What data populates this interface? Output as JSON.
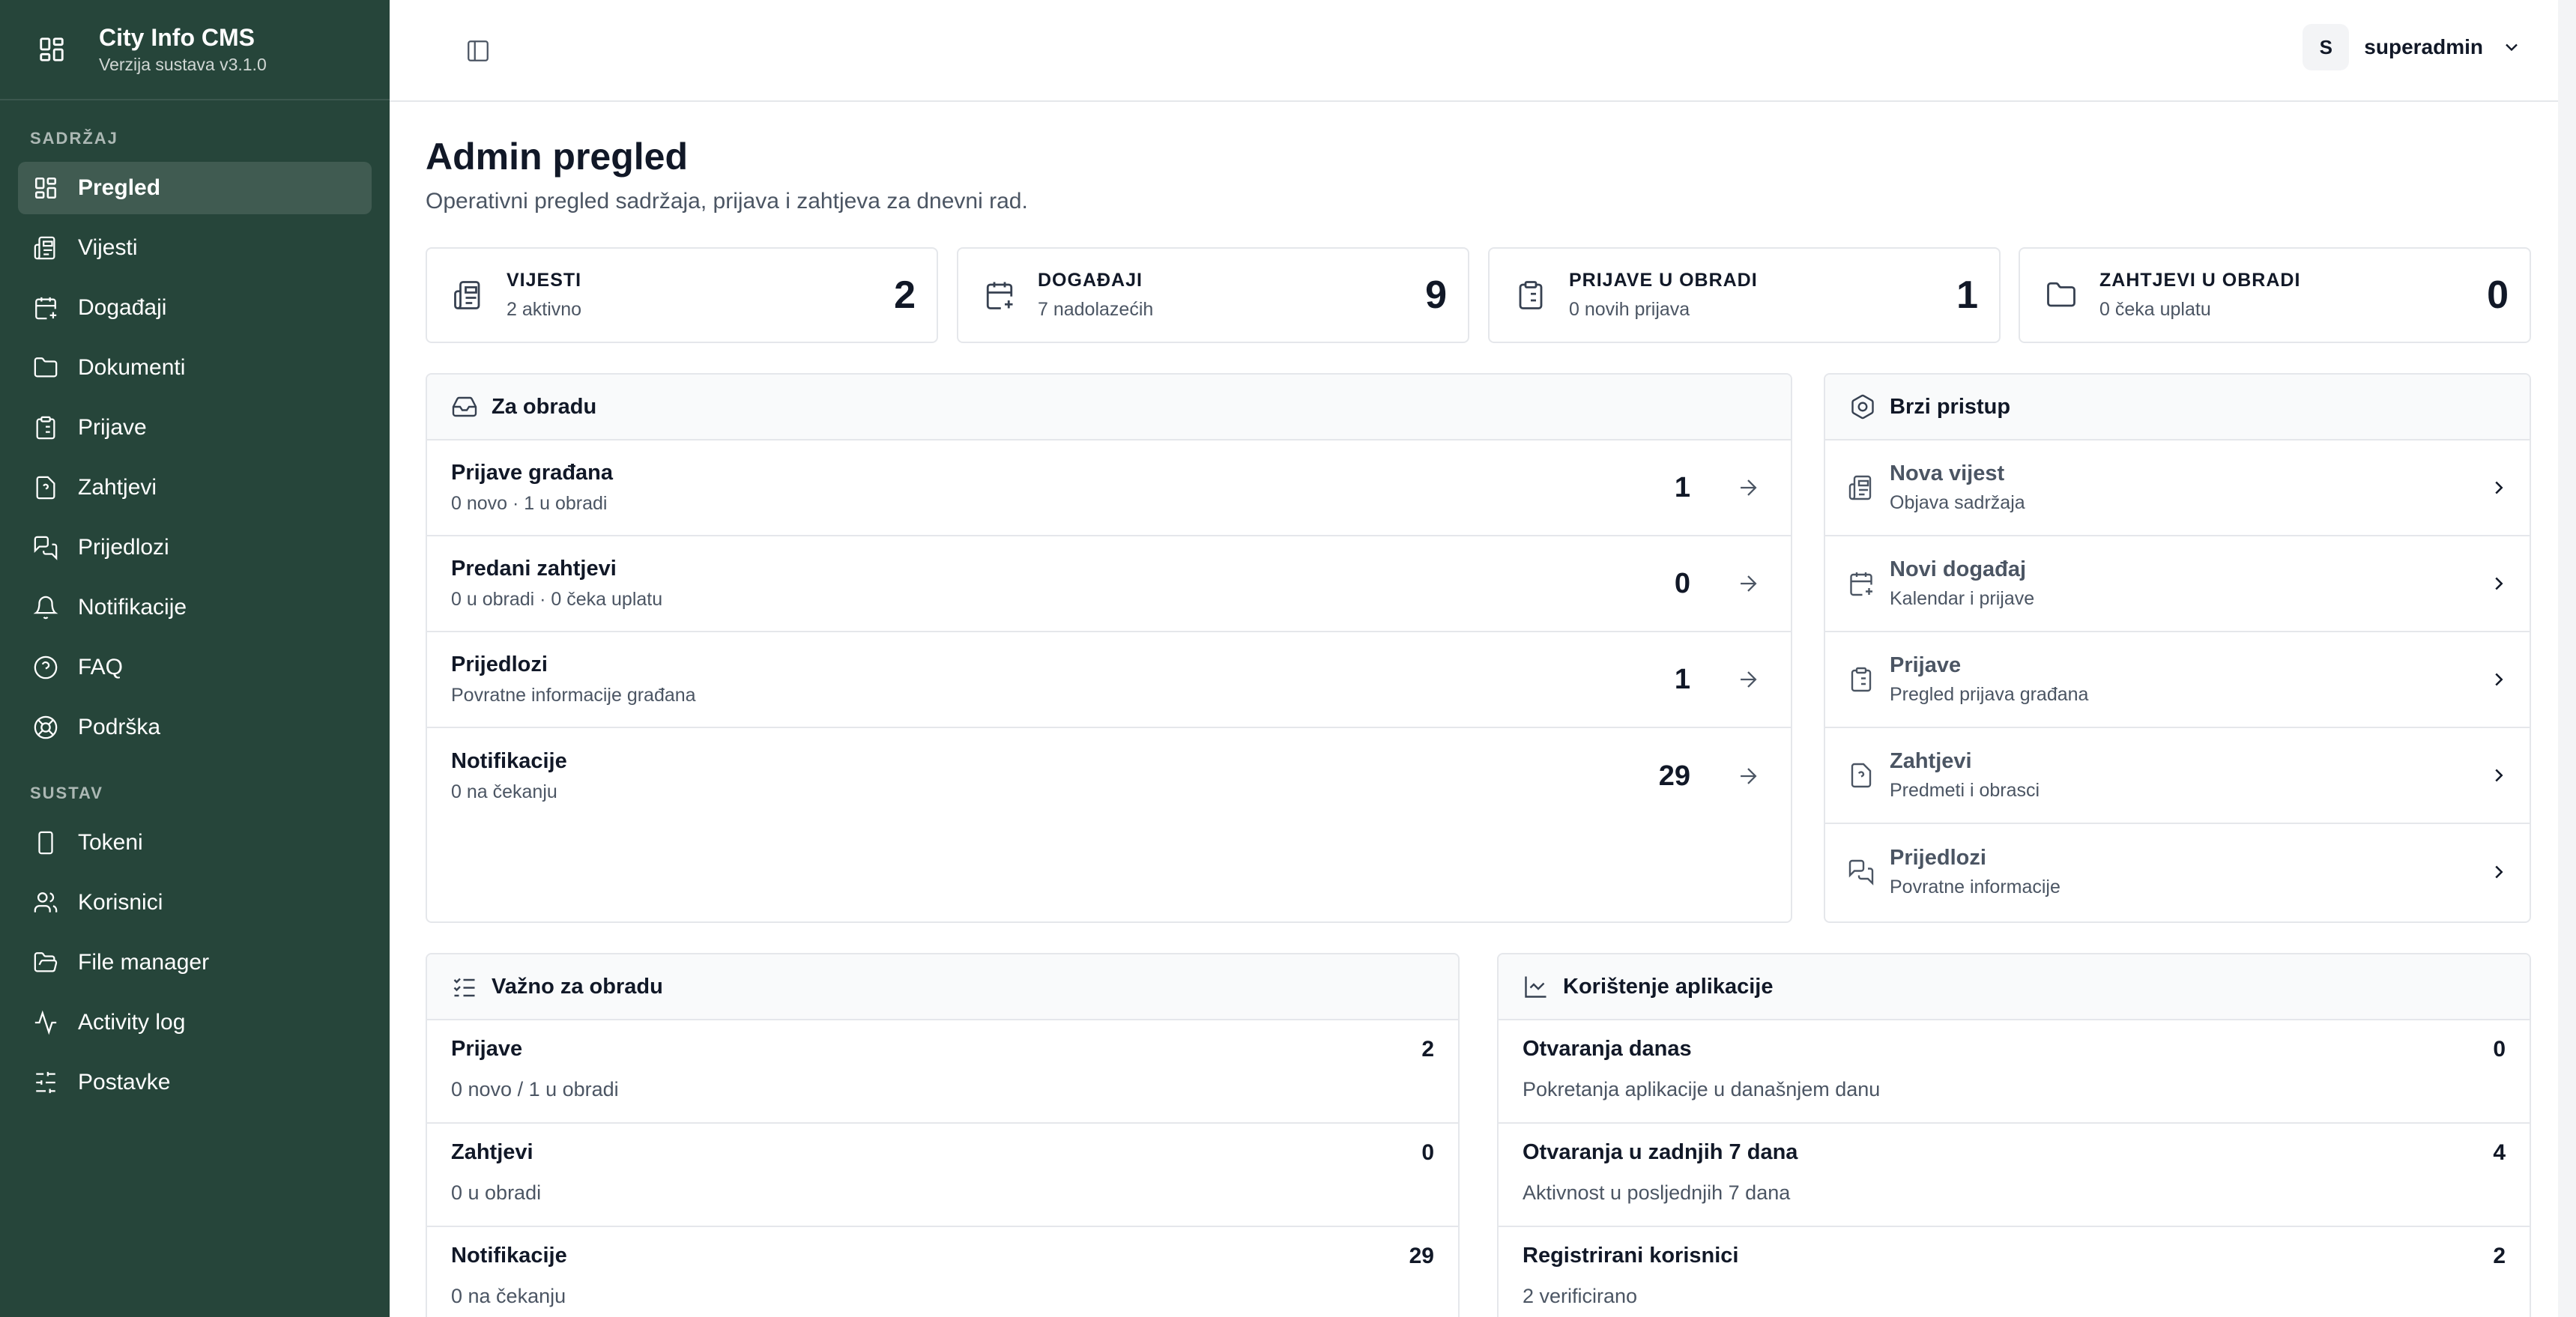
{
  "app": {
    "name": "City Info CMS",
    "version": "Verzija sustava v3.1.0"
  },
  "sidebar": {
    "sections": [
      "SADRŽAJ",
      "SUSTAV"
    ],
    "content_items": [
      {
        "label": "Pregled",
        "icon": "dashboard-icon",
        "active": true
      },
      {
        "label": "Vijesti",
        "icon": "newspaper-icon"
      },
      {
        "label": "Događaji",
        "icon": "calendar-plus-icon"
      },
      {
        "label": "Dokumenti",
        "icon": "folder-icon"
      },
      {
        "label": "Prijave",
        "icon": "clipboard-icon"
      },
      {
        "label": "Zahtjevi",
        "icon": "file-question-icon"
      },
      {
        "label": "Prijedlozi",
        "icon": "messages-icon"
      },
      {
        "label": "Notifikacije",
        "icon": "bell-icon"
      },
      {
        "label": "FAQ",
        "icon": "help-circle-icon"
      },
      {
        "label": "Podrška",
        "icon": "life-buoy-icon"
      }
    ],
    "system_items": [
      {
        "label": "Tokeni",
        "icon": "phone-icon"
      },
      {
        "label": "Korisnici",
        "icon": "users-icon"
      },
      {
        "label": "File manager",
        "icon": "folder-open-icon"
      },
      {
        "label": "Activity log",
        "icon": "activity-icon"
      },
      {
        "label": "Postavke",
        "icon": "sliders-icon"
      }
    ]
  },
  "header": {
    "user_initial": "S",
    "user_name": "superadmin"
  },
  "page": {
    "title": "Admin pregled",
    "subtitle": "Operativni pregled sadržaja, prijava i zahtjeva za dnevni rad."
  },
  "stats": [
    {
      "label": "VIJESTI",
      "sub": "2 aktivno",
      "value": "2"
    },
    {
      "label": "DOGAĐAJI",
      "sub": "7 nadolazećih",
      "value": "9"
    },
    {
      "label": "PRIJAVE U OBRADI",
      "sub": "0 novih prijava",
      "value": "1"
    },
    {
      "label": "ZAHTJEVI U OBRADI",
      "sub": "0 čeka uplatu",
      "value": "0"
    }
  ],
  "za_obradu": {
    "title": "Za obradu",
    "rows": [
      {
        "title": "Prijave građana",
        "sub": "0 novo · 1 u obradi",
        "count": "1"
      },
      {
        "title": "Predani zahtjevi",
        "sub": "0 u obradi · 0 čeka uplatu",
        "count": "0"
      },
      {
        "title": "Prijedlozi",
        "sub": "Povratne informacije građana",
        "count": "1"
      },
      {
        "title": "Notifikacije",
        "sub": "0 na čekanju",
        "count": "29"
      }
    ]
  },
  "brzi_pristup": {
    "title": "Brzi pristup",
    "rows": [
      {
        "title": "Nova vijest",
        "sub": "Objava sadržaja",
        "icon": "newspaper-icon"
      },
      {
        "title": "Novi događaj",
        "sub": "Kalendar i prijave",
        "icon": "calendar-plus-icon"
      },
      {
        "title": "Prijave",
        "sub": "Pregled prijava građana",
        "icon": "clipboard-icon"
      },
      {
        "title": "Zahtjevi",
        "sub": "Predmeti i obrasci",
        "icon": "file-question-icon"
      },
      {
        "title": "Prijedlozi",
        "sub": "Povratne informacije",
        "icon": "messages-icon"
      }
    ]
  },
  "vazno": {
    "title": "Važno za obradu",
    "rows": [
      {
        "title": "Prijave",
        "sub": "0 novo / 1 u obradi",
        "value": "2"
      },
      {
        "title": "Zahtjevi",
        "sub": "0 u obradi",
        "value": "0"
      },
      {
        "title": "Notifikacije",
        "sub": "0 na čekanju",
        "value": "29"
      }
    ]
  },
  "koristenje": {
    "title": "Korištenje aplikacije",
    "rows": [
      {
        "title": "Otvaranja danas",
        "sub": "Pokretanja aplikacije u današnjem danu",
        "value": "0"
      },
      {
        "title": "Otvaranja u zadnjih 7 dana",
        "sub": "Aktivnost u posljednjih 7 dana",
        "value": "4"
      },
      {
        "title": "Registrirani korisnici",
        "sub": "2 verificirano",
        "value": "2"
      }
    ]
  }
}
